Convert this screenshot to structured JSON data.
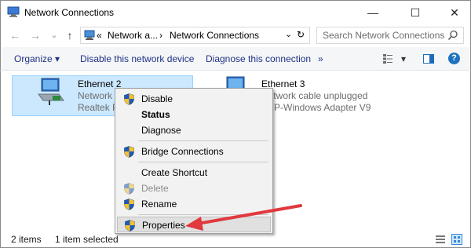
{
  "window": {
    "title": "Network Connections",
    "minimize_glyph": "—",
    "maximize_glyph": "☐",
    "close_glyph": "✕"
  },
  "nav": {
    "back_glyph": "←",
    "forward_glyph": "→",
    "recent_glyph": "⌄",
    "up_glyph": "↑"
  },
  "address": {
    "overflow": "«",
    "crumb1": "Network a...",
    "sep1": "›",
    "crumb2": "Network Connections",
    "sep2": "›",
    "dropdown_glyph": "⌄",
    "refresh_glyph": "↻"
  },
  "search": {
    "placeholder": "Search Network Connections"
  },
  "toolbar": {
    "organize": "Organize ▾",
    "disable": "Disable this network device",
    "diagnose": "Diagnose this connection",
    "more": "»",
    "view_dropdown": "▾",
    "help": "?"
  },
  "items": [
    {
      "name": "Ethernet 2",
      "line2": "Network",
      "line3": "Realtek PC"
    },
    {
      "name": "Ethernet 3",
      "line2": "Network cable unplugged",
      "line3": "P-Windows Adapter V9"
    }
  ],
  "context_menu": {
    "disable": "Disable",
    "status": "Status",
    "diagnose": "Diagnose",
    "bridge": "Bridge Connections",
    "create_shortcut": "Create Shortcut",
    "delete": "Delete",
    "rename": "Rename",
    "properties": "Properties"
  },
  "status": {
    "count": "2 items",
    "selected": "1 item selected"
  },
  "colors": {
    "selection_bg": "#cce8ff",
    "accent_blue": "#1e3287",
    "arrow_red": "#e0393e"
  }
}
